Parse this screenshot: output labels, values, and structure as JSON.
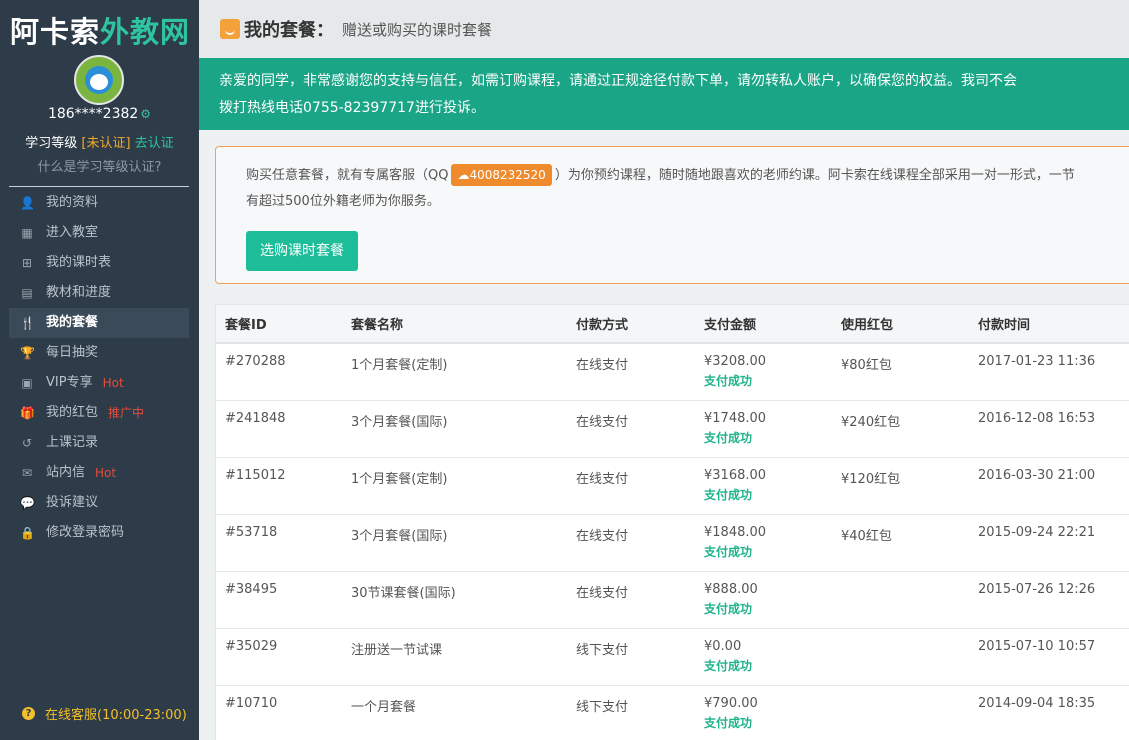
{
  "logo": {
    "part1": "阿卡索",
    "part2": "外教网"
  },
  "user": {
    "phone": "186****2382",
    "level_label": "学习等级",
    "level_status": "[未认证]",
    "verify_link": "去认证",
    "what_is": "什么是学习等级认证?"
  },
  "menu": [
    {
      "label": "我的资料",
      "icon": "user-icon",
      "tag": ""
    },
    {
      "label": "进入教室",
      "icon": "calendar-icon",
      "tag": ""
    },
    {
      "label": "我的课时表",
      "icon": "grid-icon",
      "tag": ""
    },
    {
      "label": "教材和进度",
      "icon": "book-icon",
      "tag": ""
    },
    {
      "label": "我的套餐",
      "icon": "cutlery-icon",
      "tag": ""
    },
    {
      "label": "每日抽奖",
      "icon": "trophy-icon",
      "tag": ""
    },
    {
      "label": "VIP专享",
      "icon": "vip-icon",
      "tag": "Hot"
    },
    {
      "label": "我的红包",
      "icon": "gift-icon",
      "tag": "推广中"
    },
    {
      "label": "上课记录",
      "icon": "history-icon",
      "tag": ""
    },
    {
      "label": "站内信",
      "icon": "mail-icon",
      "tag": "Hot"
    },
    {
      "label": "投诉建议",
      "icon": "comments-icon",
      "tag": ""
    },
    {
      "label": "修改登录密码",
      "icon": "lock-icon",
      "tag": ""
    }
  ],
  "support": "在线客服(10:00-23:00)",
  "header": {
    "title": "我的套餐：",
    "subtitle": "赠送或购买的课时套餐"
  },
  "notice": {
    "line1": "亲爱的同学，非常感谢您的支持与信任，如需订购课程，请通过正规途径付款下单，请勿转私人账户，以确保您的权益。我司不会",
    "line2": "拨打热线电话0755-82397717进行投诉。"
  },
  "promo": {
    "text_before": "购买任意套餐，就有专属客服（QQ",
    "qq": "4008232520",
    "text_after": "）为你预约课程，随时随地跟喜欢的老师约课。阿卡索在线课程全部采用一对一形式，一节",
    "line2": "有超过500位外籍老师为你服务。",
    "button": "选购课时套餐"
  },
  "table": {
    "headers": [
      "套餐ID",
      "套餐名称",
      "付款方式",
      "支付金额",
      "使用红包",
      "付款时间"
    ],
    "rows": [
      {
        "id": "#270288",
        "name": "1个月套餐(定制)",
        "method": "在线支付",
        "amount": "¥3208.00",
        "status": "支付成功",
        "coupon": "¥80红包",
        "time": "2017-01-23 11:36"
      },
      {
        "id": "#241848",
        "name": "3个月套餐(国际)",
        "method": "在线支付",
        "amount": "¥1748.00",
        "status": "支付成功",
        "coupon": "¥240红包",
        "time": "2016-12-08 16:53"
      },
      {
        "id": "#115012",
        "name": "1个月套餐(定制)",
        "method": "在线支付",
        "amount": "¥3168.00",
        "status": "支付成功",
        "coupon": "¥120红包",
        "time": "2016-03-30 21:00"
      },
      {
        "id": "#53718",
        "name": "3个月套餐(国际)",
        "method": "在线支付",
        "amount": "¥1848.00",
        "status": "支付成功",
        "coupon": "¥40红包",
        "time": "2015-09-24 22:21"
      },
      {
        "id": "#38495",
        "name": "30节课套餐(国际)",
        "method": "在线支付",
        "amount": "¥888.00",
        "status": "支付成功",
        "coupon": "",
        "time": "2015-07-26 12:26"
      },
      {
        "id": "#35029",
        "name": "注册送一节试课",
        "method": "线下支付",
        "amount": "¥0.00",
        "status": "支付成功",
        "coupon": "",
        "time": "2015-07-10 10:57"
      },
      {
        "id": "#10710",
        "name": "一个月套餐",
        "method": "线下支付",
        "amount": "¥790.00",
        "status": "支付成功",
        "coupon": "",
        "time": "2014-09-04 18:35"
      }
    ]
  }
}
